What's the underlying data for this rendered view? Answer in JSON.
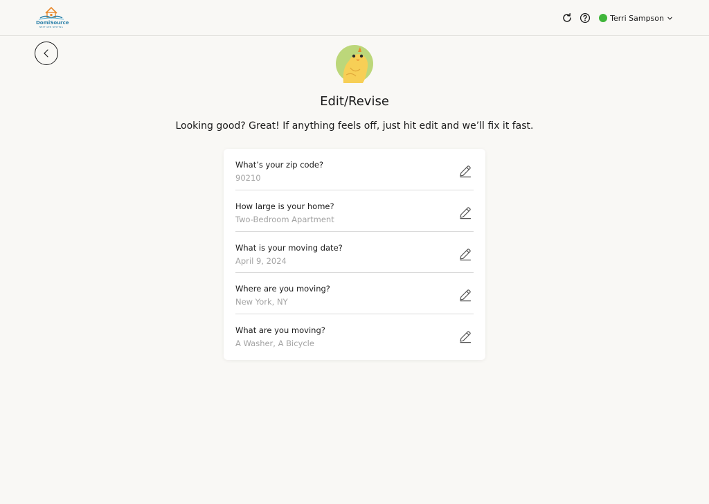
{
  "header": {
    "logo": {
      "brand": "DomiSource",
      "tagline": "NEXT GEN NESTING"
    },
    "icons": [
      "refresh-icon",
      "help-icon"
    ],
    "user": {
      "name": "Terri Sampson",
      "status_color": "#3fb53a"
    }
  },
  "page": {
    "title": "Edit/Revise",
    "subtitle": "Looking good? Great! If anything feels off, just hit edit and we’ll fix it fast."
  },
  "answers": [
    {
      "question": "What’s your zip code?",
      "answer": "90210"
    },
    {
      "question": "How large is your home?",
      "answer": "Two-Bedroom Apartment"
    },
    {
      "question": "What is your moving date?",
      "answer": "April 9, 2024"
    },
    {
      "question": "Where are you moving?",
      "answer": "New York, NY"
    },
    {
      "question": "What are you moving?",
      "answer": "A Washer, A Bicycle"
    }
  ]
}
